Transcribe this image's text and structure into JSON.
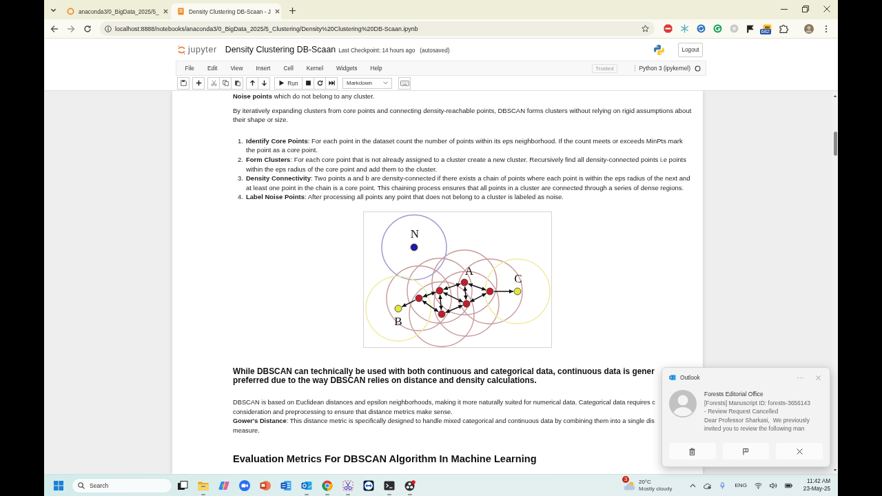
{
  "browser": {
    "tabs": [
      {
        "kind": "directory",
        "title": "anaconda3/0_BigData_2025/5_",
        "selected": false
      },
      {
        "kind": "notebook",
        "title": "Density Clustering DB-Scaan - J",
        "selected": true
      }
    ],
    "url": "localhost:8888/notebooks/anaconda3/0_BigData_2025/5_Clustering/Density%20Clustering%20DB-Scaan.ipynb",
    "extension_badge": "682"
  },
  "jupyter": {
    "logo": "jupyter",
    "title": "Density Clustering DB-Scaan",
    "checkpoint": "Last Checkpoint: 14 hours ago",
    "autosave": "(autosaved)",
    "logout": "Logout",
    "menu": [
      "File",
      "Edit",
      "View",
      "Insert",
      "Cell",
      "Kernel",
      "Widgets",
      "Help"
    ],
    "trusted": "Trusted",
    "kernel": "Python 3 (ipykernel)",
    "kernel_busy": false,
    "run": "Run",
    "cell_type": "Markdown"
  },
  "notebook": {
    "top_line": "**Noise points** which do not belong to any cluster.",
    "intro": "By iteratively expanding clusters from core points and connecting density-reachable points, DBSCAN forms clusters without relying on rigid assumptions about their shape or size.",
    "steps": [
      {
        "number": "1.",
        "text": "**Identify Core Points**: For each point in the dataset count the number of points within its eps neighborhood. If the count meets or exceeds MinPts mark the point as a core point."
      },
      {
        "number": "2.",
        "text": "**Form Clusters**: For each core point that is not already assigned to a cluster create a new cluster. Recursively find all density-connected points i.e points within the eps radius of the core point and add them to the cluster."
      },
      {
        "number": "3.",
        "text": "**Density Connectivity**: Two points a and b are density-connected if there exists a chain of points where each point is within the eps radius of the next and at least one point in the chain is a core point. This chaining process ensures that all points in a cluster are connected through a series of dense regions."
      },
      {
        "number": "4.",
        "text": "**Label Noise Points**: After processing all points any point that does not belong to a cluster is labeled as noise."
      }
    ],
    "figure": {
      "labels": [
        {
          "text": "N",
          "kind": "noise"
        },
        {
          "text": "A",
          "kind": "core"
        },
        {
          "text": "B",
          "kind": "border"
        },
        {
          "text": "C",
          "kind": "border"
        }
      ]
    },
    "heading": [
      "While DBSCAN can technically be used with both continuous and categorical data, continuous data is gener",
      "preferred due to the way DBSCAN relies on distance and density calculations."
    ],
    "paragraphs": [
      [
        "DBSCAN is based on Euclidean distances and epsilon neighborhoods, making it more naturally suited for numerical data. Categorical data requires c",
        "consideration and preprocessing to ensure that distance metrics make sense."
      ],
      [
        "**Gower's Distance**: This distance metric is specifically designed to handle mixed categorical and continuous data by combining them into a single dis",
        "measure."
      ]
    ],
    "section_heading": "Evaluation Metrics For DBSCAN Algorithm In Machine Learning"
  },
  "notification": {
    "app": "Outlook",
    "sender": "Forests Editorial Office",
    "subject": "[Forests] Manuscript ID: forests-3656143 - Review Request Cancelled",
    "body": "Dear Professor Sharkasi,  We previously invited you to review the following man"
  },
  "taskbar": {
    "search": "Search",
    "apps": [
      {
        "kind": "task-view",
        "running": false
      },
      {
        "kind": "folder",
        "running": true
      },
      {
        "kind": "assistant",
        "running": false
      },
      {
        "kind": "video",
        "running": false
      },
      {
        "kind": "slides",
        "running": false
      },
      {
        "kind": "document",
        "running": false
      },
      {
        "kind": "mail",
        "running": true
      },
      {
        "kind": "browser",
        "running": true
      },
      {
        "kind": "scissors",
        "running": true
      },
      {
        "kind": "remote",
        "running": false
      },
      {
        "kind": "terminal",
        "running": true
      },
      {
        "kind": "recorder",
        "running": true
      }
    ],
    "weather": {
      "badge": "3",
      "temperature": "20°C",
      "condition": "Mostly cloudy"
    },
    "language": "ENG",
    "time": "11:42 AM",
    "date": "23-May-25"
  }
}
